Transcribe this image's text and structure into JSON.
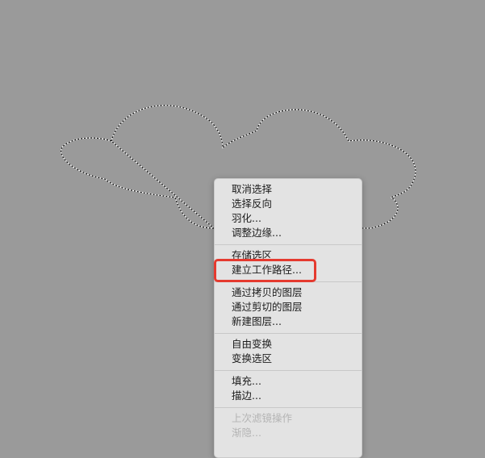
{
  "context_menu": {
    "sections": [
      {
        "items": [
          {
            "label": "取消选择",
            "enabled": true
          },
          {
            "label": "选择反向",
            "enabled": true
          },
          {
            "label": "羽化...",
            "enabled": true
          },
          {
            "label": "调整边缘...",
            "enabled": true
          }
        ]
      },
      {
        "items": [
          {
            "label": "存储选区",
            "enabled": true
          },
          {
            "label": "建立工作路径...",
            "enabled": true
          }
        ]
      },
      {
        "items": [
          {
            "label": "通过拷贝的图层",
            "enabled": true
          },
          {
            "label": "通过剪切的图层",
            "enabled": true
          },
          {
            "label": "新建图层...",
            "enabled": true
          }
        ]
      },
      {
        "items": [
          {
            "label": "自由变换",
            "enabled": true
          },
          {
            "label": "变换选区",
            "enabled": true
          }
        ]
      },
      {
        "items": [
          {
            "label": "填充...",
            "enabled": true
          },
          {
            "label": "描边...",
            "enabled": true
          }
        ]
      },
      {
        "items": [
          {
            "label": "上次滤镜操作",
            "enabled": false
          },
          {
            "label": "渐隐...",
            "enabled": false
          }
        ]
      }
    ]
  },
  "highlighted_item": "建立工作路径...",
  "colors": {
    "canvas_background": "#9a9a9a",
    "menu_background": "#e3e3e3",
    "highlight": "#e53a2f"
  }
}
